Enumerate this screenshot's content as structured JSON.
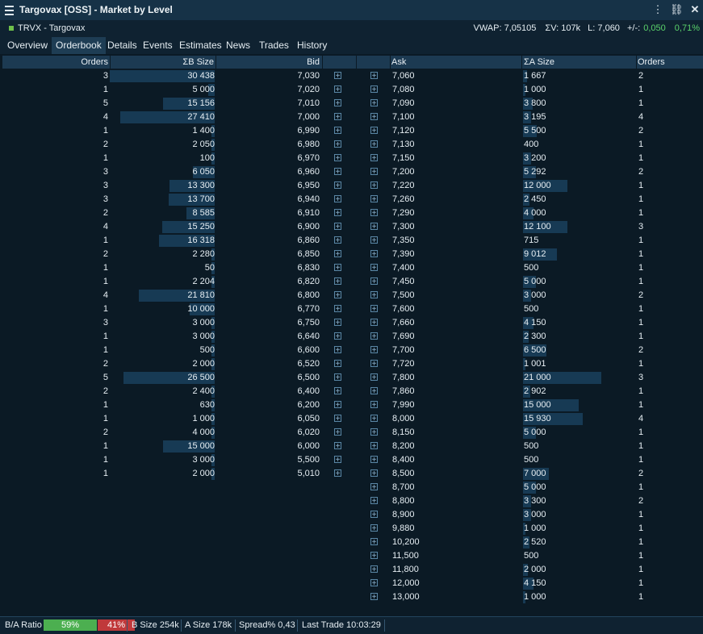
{
  "window": {
    "title": "Targovax [OSS] - Market by Level"
  },
  "symbol": {
    "code": "TRVX - Targovax",
    "vwap": "VWAP: 7,05105",
    "volume": "ΣV: 107k",
    "last": "L: 7,060",
    "change_label": "+/-:",
    "change": "0,050",
    "change_pct": "0,71%"
  },
  "tabs": [
    "Overview",
    "Orderbook",
    "Details",
    "Events",
    "Estimates",
    "News",
    "Trades",
    "History"
  ],
  "columns": {
    "bid_orders": "Orders",
    "bid_size": "ΣB Size",
    "bid": "Bid",
    "ask": "Ask",
    "ask_size": "ΣA Size",
    "ask_orders": "Orders"
  },
  "bids": [
    {
      "orders": "3",
      "size": "30 438",
      "price": "7,030",
      "depth": 1.0
    },
    {
      "orders": "1",
      "size": "5 000",
      "price": "7,020",
      "depth": 0.06
    },
    {
      "orders": "5",
      "size": "15 156",
      "price": "7,010",
      "depth": 0.49
    },
    {
      "orders": "4",
      "size": "27 410",
      "price": "7,000",
      "depth": 0.9
    },
    {
      "orders": "1",
      "size": "1 400",
      "price": "6,990",
      "depth": 0.03
    },
    {
      "orders": "2",
      "size": "2 050",
      "price": "6,980",
      "depth": 0.03
    },
    {
      "orders": "1",
      "size": "100",
      "price": "6,970",
      "depth": 0.03
    },
    {
      "orders": "3",
      "size": "6 050",
      "price": "6,960",
      "depth": 0.21
    },
    {
      "orders": "3",
      "size": "13 300",
      "price": "6,950",
      "depth": 0.43
    },
    {
      "orders": "3",
      "size": "13 700",
      "price": "6,940",
      "depth": 0.44
    },
    {
      "orders": "2",
      "size": "8 585",
      "price": "6,910",
      "depth": 0.27
    },
    {
      "orders": "4",
      "size": "15 250",
      "price": "6,900",
      "depth": 0.5
    },
    {
      "orders": "1",
      "size": "16 318",
      "price": "6,860",
      "depth": 0.53
    },
    {
      "orders": "2",
      "size": "2 280",
      "price": "6,850",
      "depth": 0.03
    },
    {
      "orders": "1",
      "size": "50",
      "price": "6,830",
      "depth": 0.03
    },
    {
      "orders": "1",
      "size": "2 204",
      "price": "6,820",
      "depth": 0.03
    },
    {
      "orders": "4",
      "size": "21 810",
      "price": "6,800",
      "depth": 0.72
    },
    {
      "orders": "1",
      "size": "10 000",
      "price": "6,770",
      "depth": 0.24
    },
    {
      "orders": "3",
      "size": "3 000",
      "price": "6,750",
      "depth": 0.03
    },
    {
      "orders": "1",
      "size": "3 000",
      "price": "6,640",
      "depth": 0.03
    },
    {
      "orders": "1",
      "size": "500",
      "price": "6,600",
      "depth": 0.03
    },
    {
      "orders": "2",
      "size": "2 000",
      "price": "6,520",
      "depth": 0.03
    },
    {
      "orders": "5",
      "size": "26 500",
      "price": "6,500",
      "depth": 0.87
    },
    {
      "orders": "2",
      "size": "2 400",
      "price": "6,400",
      "depth": 0.03
    },
    {
      "orders": "1",
      "size": "630",
      "price": "6,200",
      "depth": 0.03
    },
    {
      "orders": "1",
      "size": "1 000",
      "price": "6,050",
      "depth": 0.03
    },
    {
      "orders": "2",
      "size": "4 000",
      "price": "6,020",
      "depth": 0.03
    },
    {
      "orders": "1",
      "size": "15 000",
      "price": "6,000",
      "depth": 0.49
    },
    {
      "orders": "1",
      "size": "3 000",
      "price": "5,500",
      "depth": 0.03
    },
    {
      "orders": "1",
      "size": "2 000",
      "price": "5,010",
      "depth": 0.03
    }
  ],
  "asks": [
    {
      "price": "7,060",
      "size": "1 667",
      "orders": "2",
      "depth": 0.05
    },
    {
      "price": "7,080",
      "size": "1 000",
      "orders": "1",
      "depth": 0.03
    },
    {
      "price": "7,090",
      "size": "3 800",
      "orders": "1",
      "depth": 0.12
    },
    {
      "price": "7,100",
      "size": "3 195",
      "orders": "4",
      "depth": 0.1
    },
    {
      "price": "7,120",
      "size": "5 500",
      "orders": "2",
      "depth": 0.18
    },
    {
      "price": "7,130",
      "size": "400",
      "orders": "1",
      "depth": 0.0
    },
    {
      "price": "7,150",
      "size": "3 200",
      "orders": "1",
      "depth": 0.1
    },
    {
      "price": "7,200",
      "size": "5 292",
      "orders": "2",
      "depth": 0.17
    },
    {
      "price": "7,220",
      "size": "12 000",
      "orders": "1",
      "depth": 0.57
    },
    {
      "price": "7,260",
      "size": "2 450",
      "orders": "1",
      "depth": 0.08
    },
    {
      "price": "7,290",
      "size": "4 000",
      "orders": "1",
      "depth": 0.13
    },
    {
      "price": "7,300",
      "size": "12 100",
      "orders": "3",
      "depth": 0.57
    },
    {
      "price": "7,350",
      "size": "715",
      "orders": "1",
      "depth": 0.0
    },
    {
      "price": "7,390",
      "size": "9 012",
      "orders": "1",
      "depth": 0.43
    },
    {
      "price": "7,400",
      "size": "500",
      "orders": "1",
      "depth": 0.0
    },
    {
      "price": "7,450",
      "size": "5 000",
      "orders": "1",
      "depth": 0.16
    },
    {
      "price": "7,500",
      "size": "3 000",
      "orders": "2",
      "depth": 0.1
    },
    {
      "price": "7,600",
      "size": "500",
      "orders": "1",
      "depth": 0.0
    },
    {
      "price": "7,660",
      "size": "4 150",
      "orders": "1",
      "depth": 0.13
    },
    {
      "price": "7,690",
      "size": "2 300",
      "orders": "1",
      "depth": 0.07
    },
    {
      "price": "7,700",
      "size": "6 500",
      "orders": "2",
      "depth": 0.3
    },
    {
      "price": "7,720",
      "size": "1 001",
      "orders": "1",
      "depth": 0.03
    },
    {
      "price": "7,800",
      "size": "21 000",
      "orders": "3",
      "depth": 1.0
    },
    {
      "price": "7,860",
      "size": "2 902",
      "orders": "1",
      "depth": 0.09
    },
    {
      "price": "7,990",
      "size": "15 000",
      "orders": "1",
      "depth": 0.71
    },
    {
      "price": "8,000",
      "size": "15 930",
      "orders": "4",
      "depth": 0.76
    },
    {
      "price": "8,150",
      "size": "5 000",
      "orders": "1",
      "depth": 0.16
    },
    {
      "price": "8,200",
      "size": "500",
      "orders": "1",
      "depth": 0.0
    },
    {
      "price": "8,400",
      "size": "500",
      "orders": "1",
      "depth": 0.0
    },
    {
      "price": "8,500",
      "size": "7 000",
      "orders": "2",
      "depth": 0.33
    },
    {
      "price": "8,700",
      "size": "5 000",
      "orders": "1",
      "depth": 0.16
    },
    {
      "price": "8,800",
      "size": "3 300",
      "orders": "2",
      "depth": 0.1
    },
    {
      "price": "8,900",
      "size": "3 000",
      "orders": "1",
      "depth": 0.1
    },
    {
      "price": "9,880",
      "size": "1 000",
      "orders": "1",
      "depth": 0.03
    },
    {
      "price": "10,200",
      "size": "2 520",
      "orders": "1",
      "depth": 0.08
    },
    {
      "price": "11,500",
      "size": "500",
      "orders": "1",
      "depth": 0.0
    },
    {
      "price": "11,800",
      "size": "2 000",
      "orders": "1",
      "depth": 0.06
    },
    {
      "price": "12,000",
      "size": "4 150",
      "orders": "1",
      "depth": 0.13
    },
    {
      "price": "13,000",
      "size": "1 000",
      "orders": "1",
      "depth": 0.03
    }
  ],
  "status": {
    "ratio_label": "B/A Ratio",
    "bid_pct": "59%",
    "ask_pct": "41%",
    "bid_share": 0.59,
    "b_size": "B Size 254k",
    "a_size": "A Size 178k",
    "spread": "Spread% 0,43",
    "last_trade": "Last Trade 10:03:29"
  },
  "colors": {
    "bar": "#173a54",
    "green": "#5bd36b",
    "ratio_bid": "#4caf50",
    "ratio_ask": "#c0393b"
  }
}
